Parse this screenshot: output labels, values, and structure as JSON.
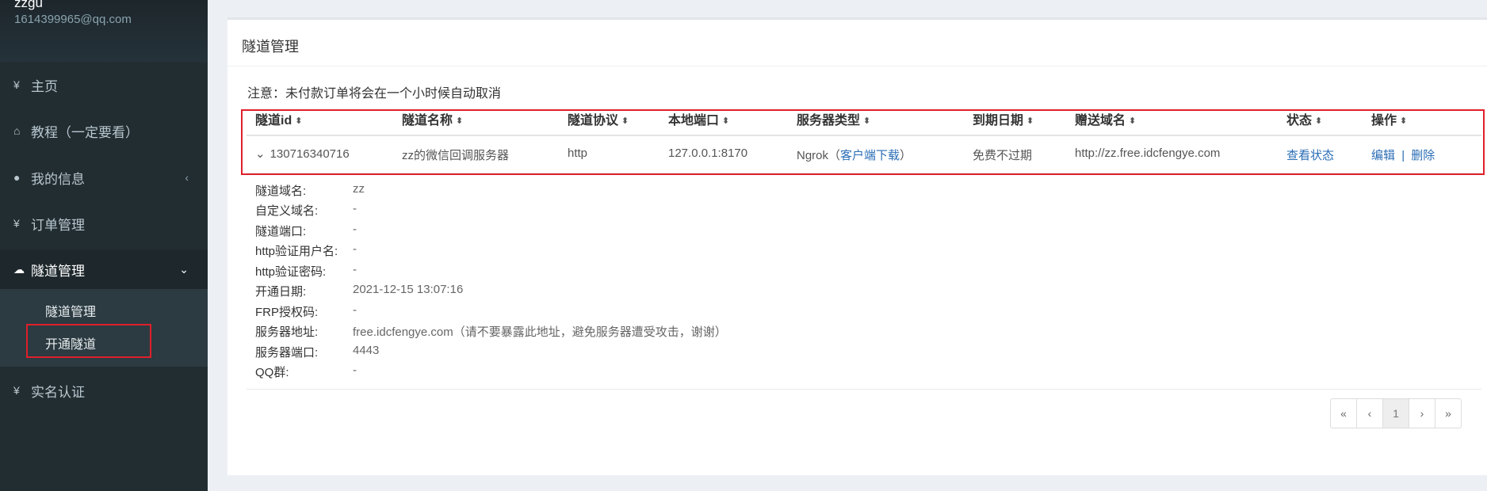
{
  "user": {
    "name": "zzgu",
    "email": "1614399965@qq.com"
  },
  "sidebar": {
    "items": [
      {
        "icon": "¥",
        "label": "主页"
      },
      {
        "icon": "⌂",
        "label": "教程（一定要看）"
      },
      {
        "icon": "●",
        "label": "我的信息",
        "chevron": "‹"
      },
      {
        "icon": "¥",
        "label": "订单管理"
      },
      {
        "icon": "☁",
        "label": "隧道管理",
        "chevron": "⌄"
      },
      {
        "icon": "¥",
        "label": "实名认证"
      }
    ],
    "submenu": [
      {
        "label": "隧道管理"
      },
      {
        "label": "开通隧道"
      }
    ]
  },
  "card": {
    "title": "隧道管理",
    "notice": "注意：未付款订单将会在一个小时候自动取消"
  },
  "table": {
    "headers": [
      "隧道id",
      "隧道名称",
      "隧道协议",
      "本地端口",
      "服务器类型",
      "到期日期",
      "赠送域名",
      "状态",
      "操作"
    ],
    "sort_icon": "⬍",
    "row": {
      "expand_icon": "⌄",
      "id": "130716340716",
      "name": "zz的微信回调服务器",
      "protocol": "http",
      "local_port": "127.0.0.1:8170",
      "server_type_prefix": "Ngrok（",
      "client_download": "客户端下载",
      "server_type_suffix": "）",
      "expiry": "免费不过期",
      "domain": "http://zz.free.idcfengye.com",
      "status_link": "查看状态",
      "edit": "编辑",
      "separator": "|",
      "delete": "删除"
    }
  },
  "details": [
    {
      "label": "隧道域名:",
      "value": "zz"
    },
    {
      "label": "自定义域名:",
      "value": "-"
    },
    {
      "label": "隧道端口:",
      "value": "-"
    },
    {
      "label": "http验证用户名:",
      "value": "-"
    },
    {
      "label": "http验证密码:",
      "value": "-"
    },
    {
      "label": "开通日期:",
      "value": "2021-12-15 13:07:16"
    },
    {
      "label": "FRP授权码:",
      "value": "-"
    },
    {
      "label": "服务器地址:",
      "value": "free.idcfengye.com（请不要暴露此地址，避免服务器遭受攻击，谢谢）"
    },
    {
      "label": "服务器端口:",
      "value": "4443"
    },
    {
      "label": "QQ群:",
      "value": "-"
    }
  ],
  "pagination": {
    "first": "«",
    "prev": "‹",
    "current": "1",
    "next": "›",
    "last": "»"
  },
  "colors": {
    "sidebar_bg": "#222d32",
    "link": "#2a6db5",
    "highlight_box": "#e01f2b"
  }
}
